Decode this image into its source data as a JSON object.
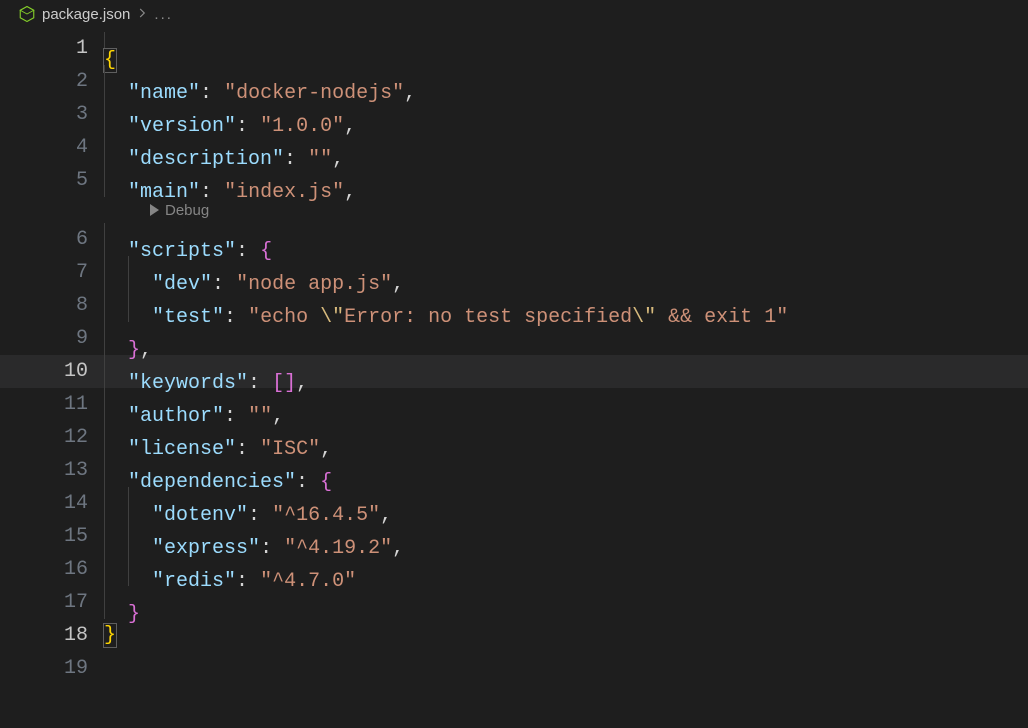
{
  "breadcrumb": {
    "filename": "package.json",
    "ellipsis": "..."
  },
  "codelens": {
    "scripts_debug": "Debug"
  },
  "lines": {
    "l1": "1",
    "l2": "2",
    "l3": "3",
    "l4": "4",
    "l5": "5",
    "l6": "6",
    "l7": "7",
    "l8": "8",
    "l9": "9",
    "l10": "10",
    "l11": "11",
    "l12": "12",
    "l13": "13",
    "l14": "14",
    "l15": "15",
    "l16": "16",
    "l17": "17",
    "l18": "18",
    "l19": "19"
  },
  "json": {
    "open_brace": "{",
    "close_brace": "}",
    "open_brace2": "{",
    "close_brace2": "}",
    "open_bracket2": "[",
    "close_bracket2": "]",
    "colon": ":",
    "comma": ",",
    "space": " ",
    "keys": {
      "name": "\"name\"",
      "version": "\"version\"",
      "description": "\"description\"",
      "main": "\"main\"",
      "scripts": "\"scripts\"",
      "dev": "\"dev\"",
      "test": "\"test\"",
      "keywords": "\"keywords\"",
      "author": "\"author\"",
      "license": "\"license\"",
      "dependencies": "\"dependencies\"",
      "dotenv": "\"dotenv\"",
      "express": "\"express\"",
      "redis": "\"redis\""
    },
    "vals": {
      "name": "\"docker-nodejs\"",
      "version": "\"1.0.0\"",
      "description": "\"\"",
      "main": "\"index.js\"",
      "dev": "\"node app.js\"",
      "test_prefix": "\"echo ",
      "test_esc1": "\\\"",
      "test_mid": "Error: no test specified",
      "test_esc2": "\\\"",
      "test_suffix": " && exit 1\"",
      "author": "\"\"",
      "license": "\"ISC\"",
      "dotenv": "\"^16.4.5\"",
      "express": "\"^4.19.2\"",
      "redis": "\"^4.7.0\""
    }
  }
}
